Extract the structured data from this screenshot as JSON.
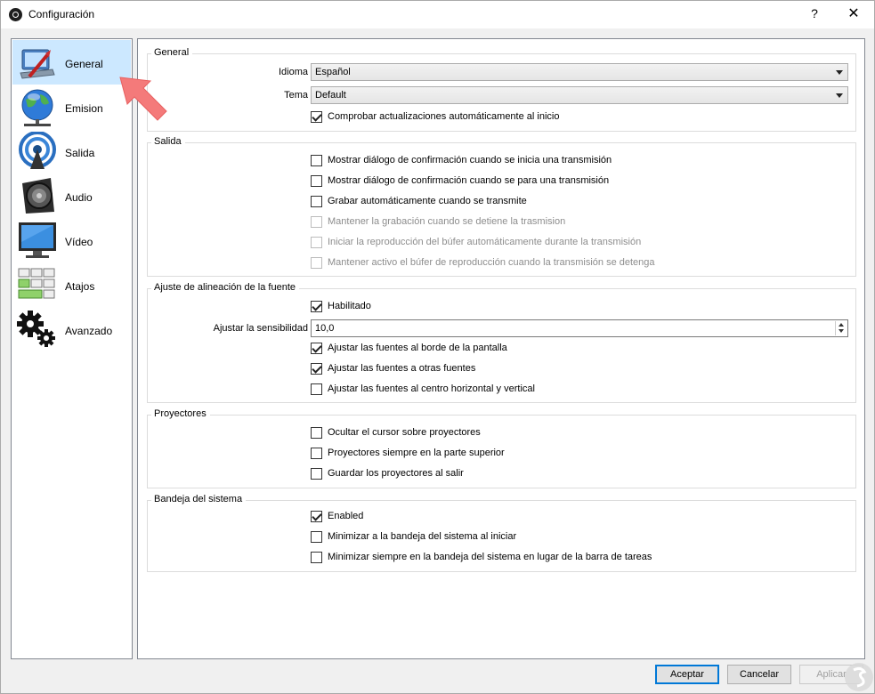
{
  "window": {
    "title": "Configuración",
    "help_glyph": "?",
    "close_glyph": "✕"
  },
  "sidebar": {
    "items": [
      {
        "label": "General",
        "icon": "general-settings-icon",
        "selected": true
      },
      {
        "label": "Emision",
        "icon": "globe-network-icon",
        "selected": false
      },
      {
        "label": "Salida",
        "icon": "broadcast-antenna-icon",
        "selected": false
      },
      {
        "label": "Audio",
        "icon": "speaker-icon",
        "selected": false
      },
      {
        "label": "Vídeo",
        "icon": "monitor-icon",
        "selected": false
      },
      {
        "label": "Atajos",
        "icon": "keyboard-icon",
        "selected": false
      },
      {
        "label": "Avanzado",
        "icon": "gears-icon",
        "selected": false
      }
    ]
  },
  "general": {
    "title": "General",
    "language_label": "Idioma",
    "language_value": "Español",
    "theme_label": "Tema",
    "theme_value": "Default",
    "check_updates": {
      "label": "Comprobar actualizaciones automáticamente al inicio",
      "checked": true
    }
  },
  "output": {
    "title": "Salida",
    "options": [
      {
        "label": "Mostrar diálogo de confirmación cuando se inicia una transmisión",
        "checked": false,
        "enabled": true
      },
      {
        "label": "Mostrar diálogo de confirmación cuando se para una transmisión",
        "checked": false,
        "enabled": true
      },
      {
        "label": "Grabar automáticamente cuando se transmite",
        "checked": false,
        "enabled": true
      },
      {
        "label": "Mantener la grabación cuando se detiene la trasmision",
        "checked": false,
        "enabled": false
      },
      {
        "label": "Iniciar la reproducción del búfer automáticamente durante la transmisión",
        "checked": false,
        "enabled": false
      },
      {
        "label": "Mantener activo el búfer de reproducción cuando la transmisión se detenga",
        "checked": false,
        "enabled": false
      }
    ]
  },
  "snapping": {
    "title": "Ajuste de alineación de la fuente",
    "enabled": {
      "label": "Habilitado",
      "checked": true
    },
    "sensitivity_label": "Ajustar la sensibilidad",
    "sensitivity_value": "10,0",
    "options": [
      {
        "label": "Ajustar las fuentes al borde de la pantalla",
        "checked": true
      },
      {
        "label": "Ajustar las fuentes a otras fuentes",
        "checked": true
      },
      {
        "label": "Ajustar las fuentes al centro horizontal y vertical",
        "checked": false
      }
    ]
  },
  "projectors": {
    "title": "Proyectores",
    "options": [
      {
        "label": "Ocultar el cursor sobre proyectores",
        "checked": false
      },
      {
        "label": "Proyectores siempre en la parte superior",
        "checked": false
      },
      {
        "label": "Guardar los proyectores al salir",
        "checked": false
      }
    ]
  },
  "tray": {
    "title": "Bandeja del sistema",
    "options": [
      {
        "label": "Enabled",
        "checked": true
      },
      {
        "label": "Minimizar a la bandeja del sistema al iniciar",
        "checked": false
      },
      {
        "label": "Minimizar siempre en la bandeja del sistema en lugar de la barra de tareas",
        "checked": false
      }
    ]
  },
  "buttons": {
    "accept": "Aceptar",
    "cancel": "Cancelar",
    "apply": "Aplicar"
  },
  "colors": {
    "selection": "#cce8ff",
    "accent": "#0078d7",
    "arrow": "#f47a7a"
  }
}
